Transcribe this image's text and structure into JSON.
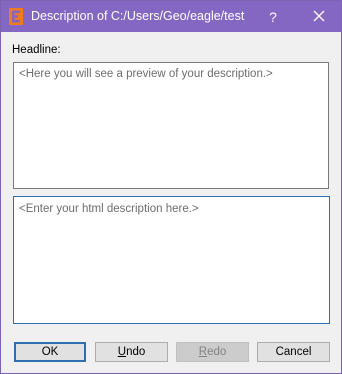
{
  "window": {
    "title": "Description of C:/Users/Geo/eagle/test",
    "help_glyph": "?",
    "close_glyph": "✕",
    "app_icon": "eagle-e-logo-icon",
    "title_bar_color": "#8467c2"
  },
  "headline": {
    "label": "Headline:"
  },
  "preview": {
    "placeholder": "<Here you will see a preview of your description.>"
  },
  "editor": {
    "placeholder": "<Enter your html description here.>"
  },
  "buttons": {
    "ok": {
      "label": "OK"
    },
    "undo": {
      "label": "Undo",
      "mnemonic": "U",
      "rest": "ndo"
    },
    "redo": {
      "label": "Redo",
      "mnemonic": "R",
      "rest": "edo",
      "enabled": false
    },
    "cancel": {
      "label": "Cancel"
    }
  }
}
